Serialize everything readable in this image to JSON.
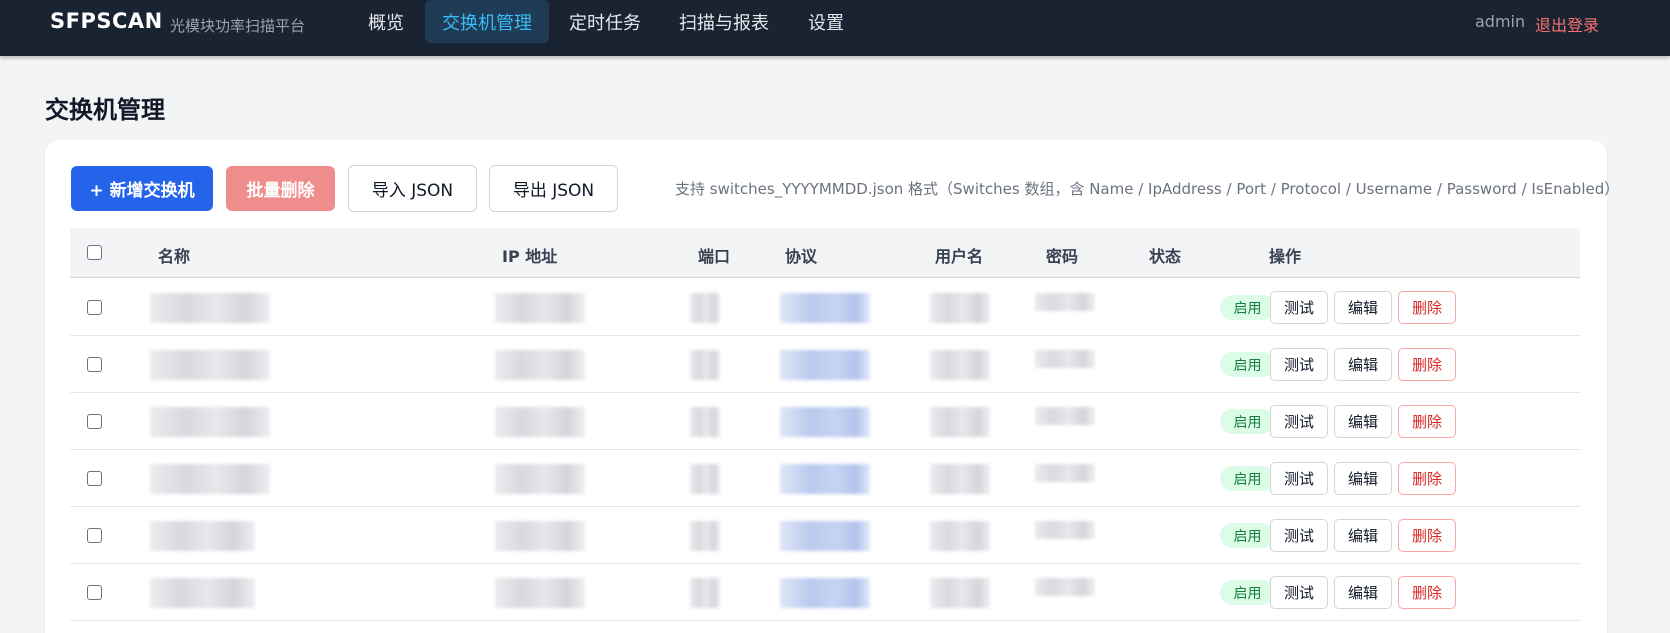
{
  "header": {
    "brand": "SFPSCAN",
    "subtitle": "光模块功率扫描平台",
    "nav": [
      "概览",
      "交换机管理",
      "定时任务",
      "扫描与报表",
      "设置"
    ],
    "active_nav": "交换机管理",
    "user": "admin",
    "logout": "退出登录"
  },
  "page": {
    "title": "交换机管理"
  },
  "toolbar": {
    "add_label": "+ 新增交换机",
    "batch_delete_label": "批量删除",
    "import_label": "导入 JSON",
    "export_label": "导出 JSON",
    "hint": "支持 switches_YYYYMMDD.json 格式（Switches 数组，含 Name / IpAddress / Port / Protocol / Username / Password / IsEnabled）"
  },
  "table": {
    "columns": [
      "名称",
      "IP 地址",
      "端口",
      "协议",
      "用户名",
      "密码",
      "状态",
      "操作"
    ],
    "rows": [
      {
        "status": "启用",
        "test": "测试",
        "edit": "编辑",
        "delete": "删除"
      },
      {
        "status": "启用",
        "test": "测试",
        "edit": "编辑",
        "delete": "删除"
      },
      {
        "status": "启用",
        "test": "测试",
        "edit": "编辑",
        "delete": "删除"
      },
      {
        "status": "启用",
        "test": "测试",
        "edit": "编辑",
        "delete": "删除"
      },
      {
        "status": "启用",
        "test": "测试",
        "edit": "编辑",
        "delete": "删除"
      },
      {
        "status": "启用",
        "test": "测试",
        "edit": "编辑",
        "delete": "删除"
      }
    ]
  },
  "colors": {
    "topbar": "#1a2332",
    "accent": "#2563eb",
    "danger": "#dc2626",
    "success": "#15803d"
  }
}
